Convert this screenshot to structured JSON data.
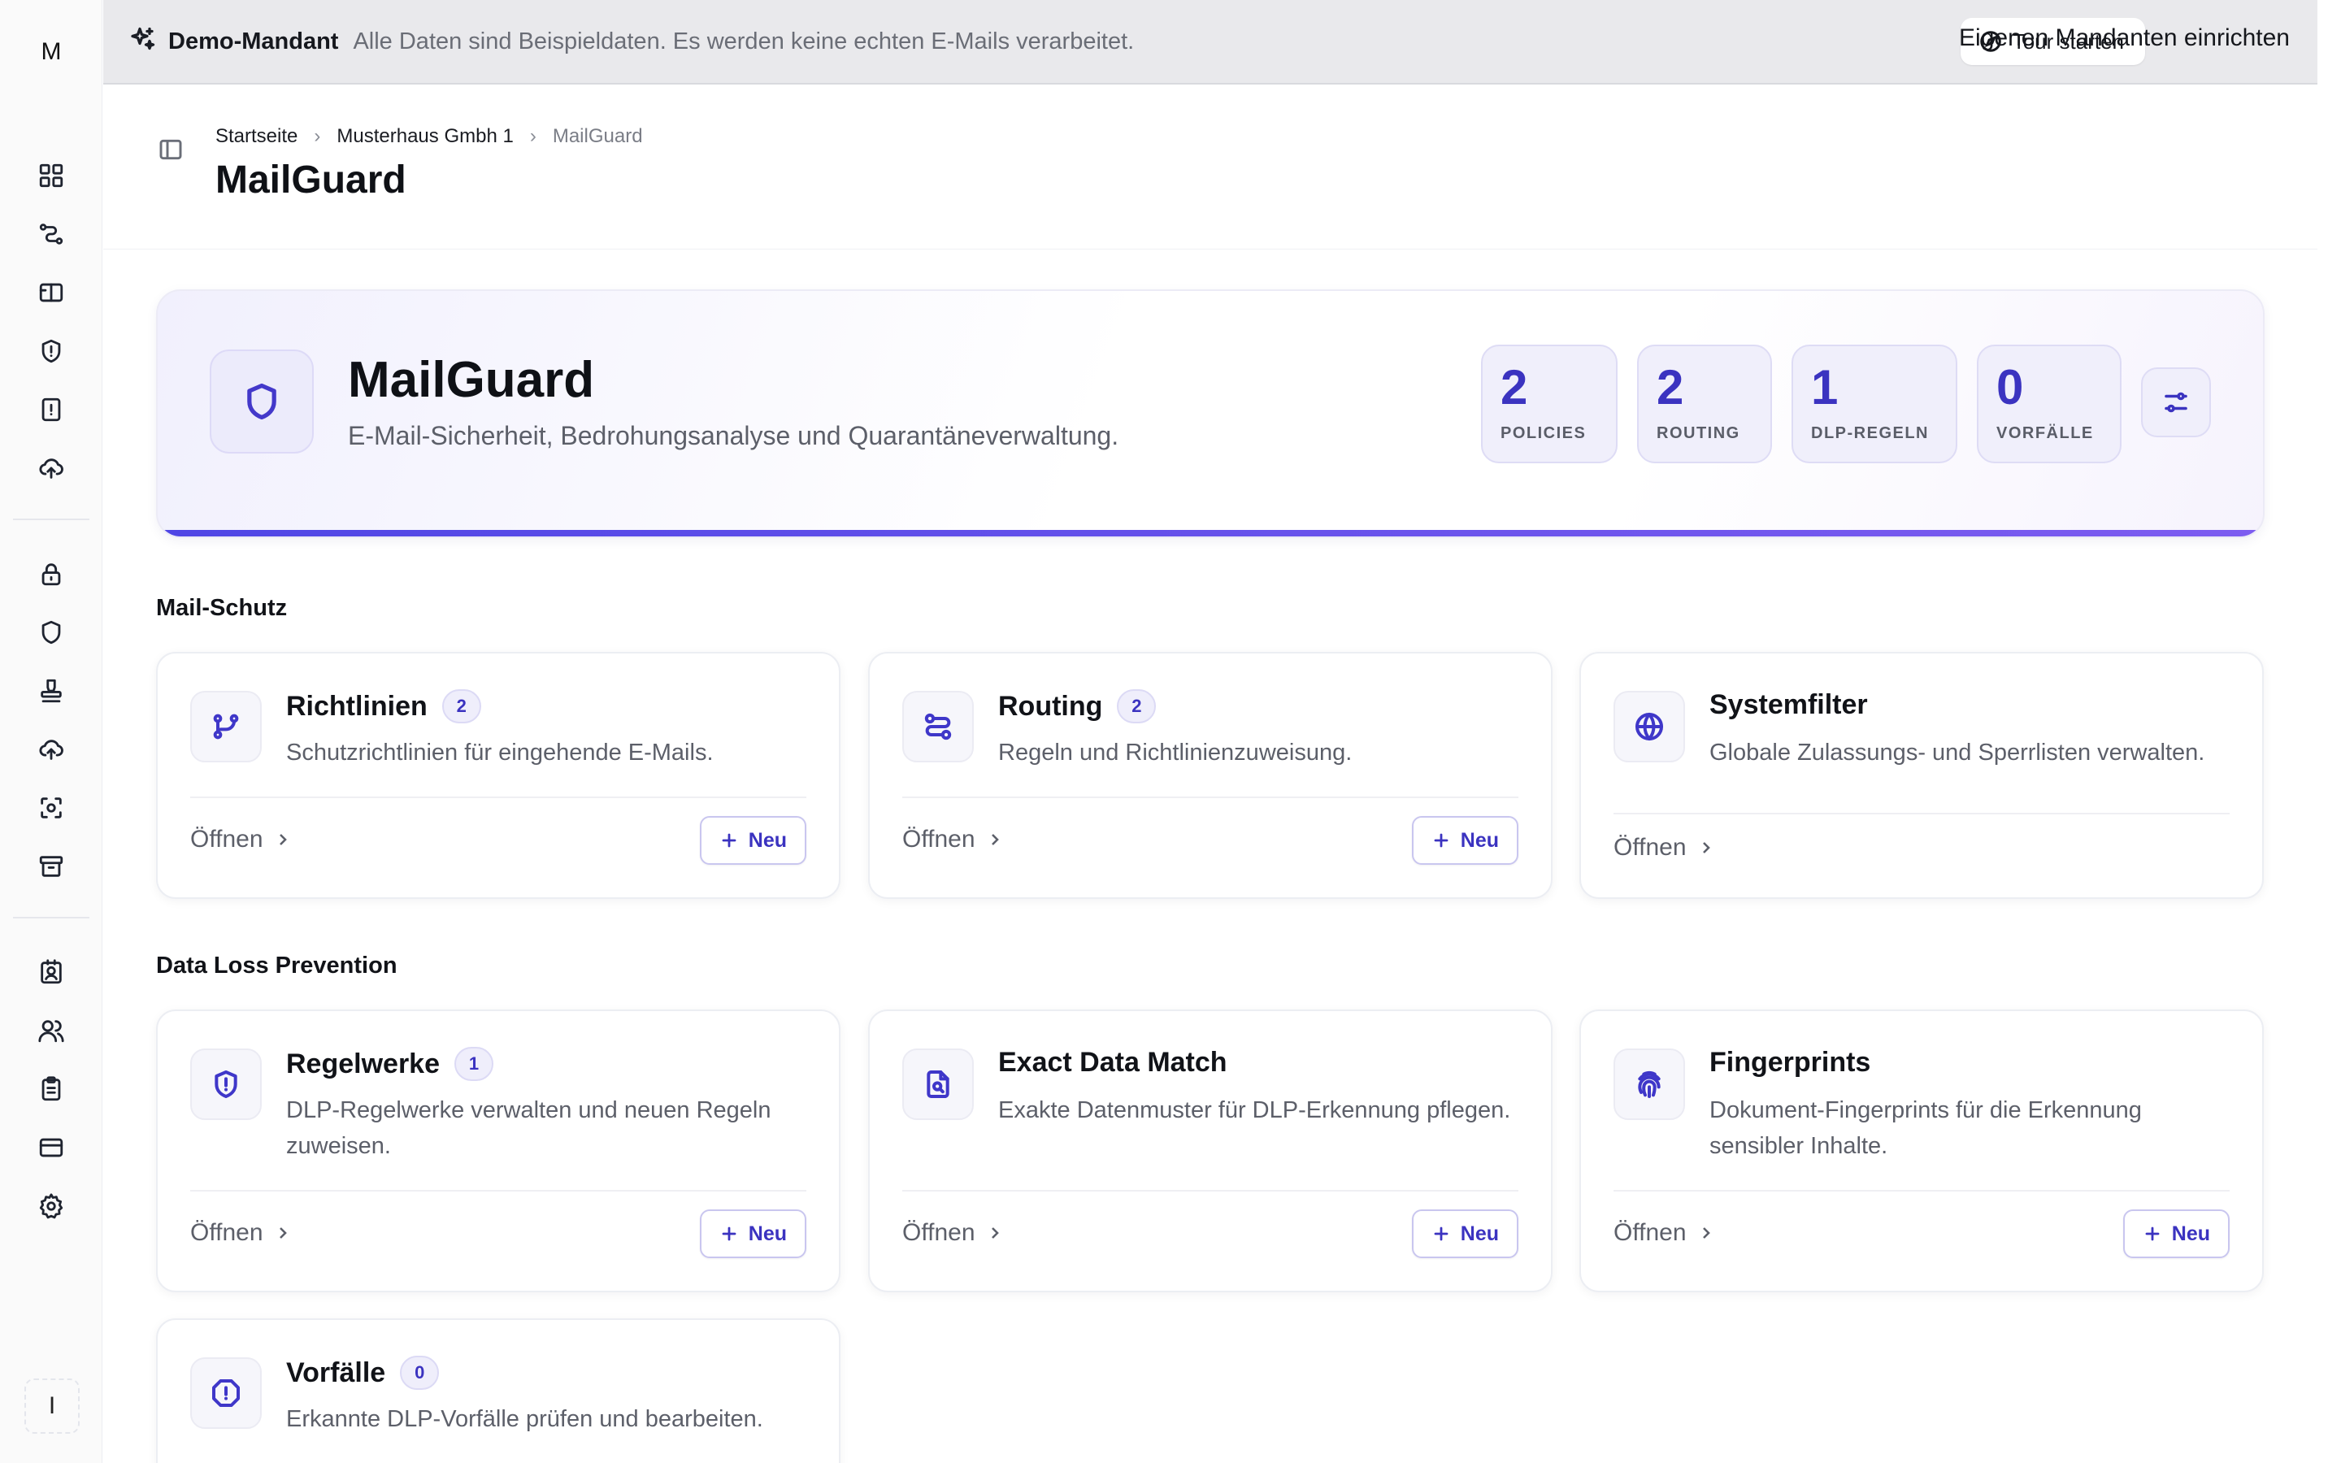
{
  "rail": {
    "logo_letter": "M",
    "user_letter": "I",
    "top_icons": [
      "dashboard-icon",
      "workflow-icon",
      "ticket-icon",
      "shield-alert-icon",
      "report-alert-icon",
      "cloud-upload-icon"
    ],
    "mid_icons": [
      "lock-icon",
      "shield-icon",
      "stamp-icon",
      "cloud-upload-icon",
      "scan-icon",
      "archive-icon"
    ],
    "bottom_icons": [
      "contact-icon",
      "users-icon",
      "clipboard-icon",
      "credit-card-icon",
      "settings-icon"
    ]
  },
  "banner": {
    "tenant": "Demo-Mandant",
    "note": "Alle Daten sind Beispieldaten. Es werden keine echten E-Mails verarbeitet.",
    "tour_label": "Tour starten",
    "own_tenant_label": "Eigenen Mandanten einrichten"
  },
  "breadcrumb": [
    "Startseite",
    "Musterhaus Gmbh 1",
    "MailGuard"
  ],
  "page_title": "MailGuard",
  "hero": {
    "title": "MailGuard",
    "subtitle": "E-Mail-Sicherheit, Bedrohungsanalyse und Quarantäneverwaltung.",
    "stats": [
      {
        "value": "2",
        "label": "POLICIES"
      },
      {
        "value": "2",
        "label": "ROUTING"
      },
      {
        "value": "1",
        "label": "DLP-REGELN"
      },
      {
        "value": "0",
        "label": "VORFÄLLE"
      }
    ],
    "accent_color": "#4f46e5"
  },
  "sections": [
    {
      "title": "Mail-Schutz",
      "cards": [
        {
          "title": "Richtlinien",
          "badge": "2",
          "description": "Schutzrichtlinien für eingehende E-Mails.",
          "open_label": "Öffnen",
          "new_label": "Neu",
          "icon": "git-branch-icon"
        },
        {
          "title": "Routing",
          "badge": "2",
          "description": "Regeln und Richtlinienzuweisung.",
          "open_label": "Öffnen",
          "new_label": "Neu",
          "icon": "route-icon"
        },
        {
          "title": "Systemfilter",
          "description": "Globale Zulassungs- und Sperrlisten verwalten.",
          "open_label": "Öffnen",
          "icon": "globe-icon"
        }
      ]
    },
    {
      "title": "Data Loss Prevention",
      "cards": [
        {
          "title": "Regelwerke",
          "badge": "1",
          "description": "DLP-Regelwerke verwalten und neuen Regeln zuweisen.",
          "open_label": "Öffnen",
          "new_label": "Neu",
          "icon": "shield-alert-icon"
        },
        {
          "title": "Exact Data Match",
          "description": "Exakte Datenmuster für DLP-Erkennung pflegen.",
          "open_label": "Öffnen",
          "new_label": "Neu",
          "icon": "file-search-icon"
        },
        {
          "title": "Fingerprints",
          "description": "Dokument-Fingerprints für die Erkennung sensibler Inhalte.",
          "open_label": "Öffnen",
          "new_label": "Neu",
          "icon": "fingerprint-icon"
        },
        {
          "title": "Vorfälle",
          "badge": "0",
          "description": "Erkannte DLP-Vorfälle prüfen und bearbeiten.",
          "icon": "alert-octagon-icon"
        }
      ]
    }
  ]
}
